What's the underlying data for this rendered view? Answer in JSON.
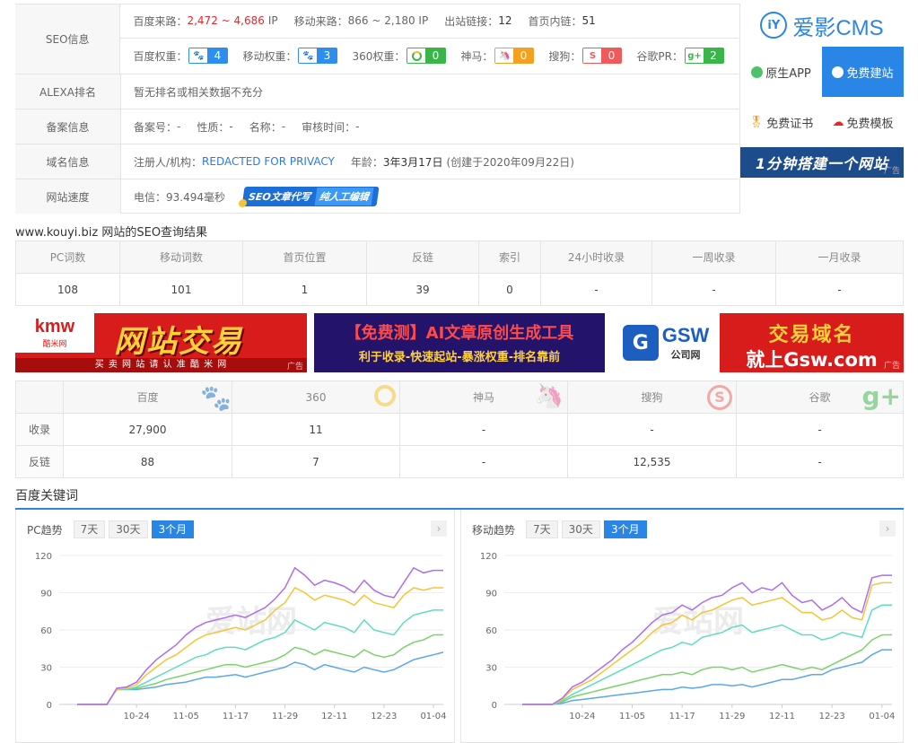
{
  "seo": {
    "head": "SEO信息",
    "baidu_flow_label": "百度来路：",
    "baidu_flow_value": "2,472 ~ 4,686",
    "ip_unit": "IP",
    "mobile_flow_label": "移动来路：",
    "mobile_flow_value": "866 ~ 2,180 IP",
    "outlinks_label": "出站链接：",
    "outlinks_value": "12",
    "inlinks_label": "首页内链：",
    "inlinks_value": "51",
    "baidu_weight_label": "百度权重：",
    "baidu_weight": "4",
    "mobile_weight_label": "移动权重：",
    "mobile_weight": "3",
    "w360_label": "360权重：",
    "w360": "0",
    "shenma_label": "神马：",
    "shenma": "0",
    "sogou_label": "搜狗：",
    "sogou": "0",
    "gpr_label": "谷歌PR：",
    "gpr": "2"
  },
  "alexa": {
    "head": "ALEXA排名",
    "value": "暂无排名或相关数据不充分"
  },
  "icp": {
    "head": "备案信息",
    "no_label": "备案号：",
    "no": "-",
    "type_label": "性质：",
    "type": "-",
    "name_label": "名称：",
    "name": "-",
    "time_label": "审核时间：",
    "time": "-"
  },
  "domain": {
    "head": "域名信息",
    "reg_label": "注册人/机构：",
    "reg": "REDACTED FOR PRIVACY",
    "age_label": "年龄：",
    "age": "3年3月17日",
    "created": "(创建于2020年09月22日)"
  },
  "speed": {
    "head": "网站速度",
    "telecom": "电信：93.494毫秒",
    "promo1": "SEO文章代写",
    "promo2": "纯人工编辑"
  },
  "side": {
    "logo": "爱影CMS",
    "app": "原生APP",
    "free_site": "免费建站",
    "cert": "免费证书",
    "template": "免费模板",
    "slogan": "1分钟搭建一个网站",
    "ad": "广告"
  },
  "result_title": "www.kouyi.biz 网站的SEO查询结果",
  "stats": {
    "headers": [
      "PC词数",
      "移动词数",
      "首页位置",
      "反链",
      "索引",
      "24小时收录",
      "一周收录",
      "一月收录"
    ],
    "values": [
      "108",
      "101",
      "1",
      "39",
      "0",
      "-",
      "-",
      "-"
    ]
  },
  "banners": {
    "b1_logo": "kmw",
    "b1_logo_sub": "酷米网",
    "b1_main": "网站交易",
    "b1_sub": "买 卖 网 站 请 认 准 酷 米 网",
    "b2_main": "【免费测】AI文章原创生成工具",
    "b2_sub": "利于收录-快速起站-暴涨权重-排名靠前",
    "b3_logo": "GSW",
    "b3_logo_sub": "公司网",
    "b3_main": "交易域名",
    "b3_sub": "就上Gsw.com",
    "ad": "广告"
  },
  "engines": {
    "headers": [
      "百度",
      "360",
      "神马",
      "搜狗",
      "谷歌"
    ],
    "rows": [
      {
        "label": "收录",
        "values": [
          "27,900",
          "11",
          "-",
          "-",
          "-"
        ]
      },
      {
        "label": "反链",
        "values": [
          "88",
          "7",
          "-",
          "12,535",
          "-"
        ]
      }
    ]
  },
  "keywords_title": "百度关键词",
  "trend": {
    "pc_label": "PC趋势",
    "mobile_label": "移动趋势",
    "tabs": [
      "7天",
      "30天",
      "3个月"
    ],
    "active_tab": "3个月",
    "watermark": "爱站网"
  },
  "chart_data": [
    {
      "type": "line",
      "title": "PC趋势",
      "x_ticks": [
        "10-24",
        "11-05",
        "11-17",
        "11-29",
        "12-11",
        "12-23",
        "01-04"
      ],
      "ylim": [
        0,
        120
      ],
      "y_ticks": [
        0,
        30,
        60,
        90,
        120
      ],
      "series": [
        {
          "color": "#b06cf0",
          "values": [
            0,
            0,
            0,
            0,
            13,
            14,
            18,
            28,
            36,
            42,
            48,
            56,
            62,
            66,
            68,
            70,
            72,
            70,
            74,
            78,
            85,
            94,
            110,
            104,
            96,
            100,
            98,
            95,
            90,
            100,
            92,
            88,
            86,
            98,
            110,
            106,
            108,
            108
          ]
        },
        {
          "color": "#f7c436",
          "values": [
            0,
            0,
            0,
            0,
            12,
            13,
            16,
            24,
            30,
            36,
            40,
            46,
            52,
            56,
            58,
            60,
            62,
            60,
            64,
            68,
            76,
            82,
            94,
            90,
            84,
            88,
            86,
            84,
            80,
            88,
            82,
            80,
            78,
            88,
            94,
            92,
            94,
            94
          ]
        },
        {
          "color": "#5fdcc0",
          "values": [
            0,
            0,
            0,
            0,
            12,
            12,
            14,
            18,
            22,
            26,
            30,
            34,
            38,
            40,
            44,
            46,
            46,
            44,
            48,
            52,
            54,
            58,
            68,
            64,
            60,
            66,
            64,
            62,
            58,
            68,
            60,
            58,
            56,
            66,
            72,
            74,
            76,
            76
          ]
        },
        {
          "color": "#7ad36a",
          "values": [
            0,
            0,
            0,
            0,
            12,
            12,
            13,
            15,
            17,
            20,
            22,
            24,
            26,
            28,
            30,
            32,
            32,
            30,
            32,
            34,
            36,
            40,
            46,
            44,
            40,
            44,
            42,
            40,
            38,
            44,
            40,
            38,
            40,
            46,
            50,
            52,
            56,
            56
          ]
        },
        {
          "color": "#5aa7ee",
          "values": [
            0,
            0,
            0,
            0,
            12,
            12,
            12,
            13,
            14,
            16,
            17,
            18,
            20,
            22,
            22,
            23,
            24,
            22,
            24,
            26,
            28,
            30,
            34,
            32,
            28,
            32,
            30,
            28,
            26,
            30,
            28,
            26,
            28,
            32,
            36,
            38,
            40,
            42
          ]
        }
      ]
    },
    {
      "type": "line",
      "title": "移动趋势",
      "x_ticks": [
        "10-24",
        "11-05",
        "11-17",
        "11-29",
        "12-11",
        "12-23",
        "01-04"
      ],
      "ylim": [
        0,
        120
      ],
      "y_ticks": [
        0,
        30,
        60,
        90,
        120
      ],
      "series": [
        {
          "color": "#b06cf0",
          "values": [
            0,
            0,
            0,
            0,
            5,
            14,
            18,
            24,
            30,
            36,
            44,
            50,
            58,
            66,
            72,
            74,
            80,
            76,
            82,
            86,
            88,
            94,
            98,
            90,
            94,
            92,
            98,
            88,
            82,
            84,
            76,
            80,
            86,
            78,
            74,
            102,
            104,
            104
          ]
        },
        {
          "color": "#f7c436",
          "values": [
            0,
            0,
            0,
            0,
            4,
            12,
            16,
            20,
            26,
            32,
            38,
            44,
            50,
            58,
            64,
            66,
            72,
            68,
            74,
            76,
            80,
            84,
            86,
            80,
            82,
            84,
            86,
            80,
            74,
            74,
            68,
            70,
            76,
            70,
            68,
            96,
            98,
            98
          ]
        },
        {
          "color": "#5fdcc0",
          "values": [
            0,
            0,
            0,
            0,
            3,
            8,
            12,
            16,
            20,
            24,
            28,
            32,
            36,
            40,
            44,
            46,
            50,
            48,
            54,
            56,
            58,
            62,
            64,
            58,
            60,
            62,
            64,
            60,
            56,
            56,
            52,
            54,
            58,
            56,
            54,
            76,
            80,
            80
          ]
        },
        {
          "color": "#7ad36a",
          "values": [
            0,
            0,
            0,
            0,
            2,
            6,
            8,
            10,
            12,
            14,
            16,
            18,
            20,
            22,
            24,
            24,
            26,
            24,
            28,
            30,
            30,
            28,
            30,
            26,
            28,
            30,
            32,
            30,
            28,
            30,
            28,
            32,
            36,
            40,
            44,
            52,
            56,
            56
          ]
        },
        {
          "color": "#5aa7ee",
          "values": [
            0,
            0,
            0,
            0,
            1,
            3,
            4,
            5,
            6,
            7,
            8,
            9,
            10,
            11,
            12,
            12,
            14,
            13,
            14,
            16,
            16,
            15,
            16,
            14,
            16,
            18,
            20,
            20,
            22,
            24,
            24,
            28,
            30,
            32,
            34,
            40,
            44,
            44
          ]
        }
      ]
    }
  ]
}
